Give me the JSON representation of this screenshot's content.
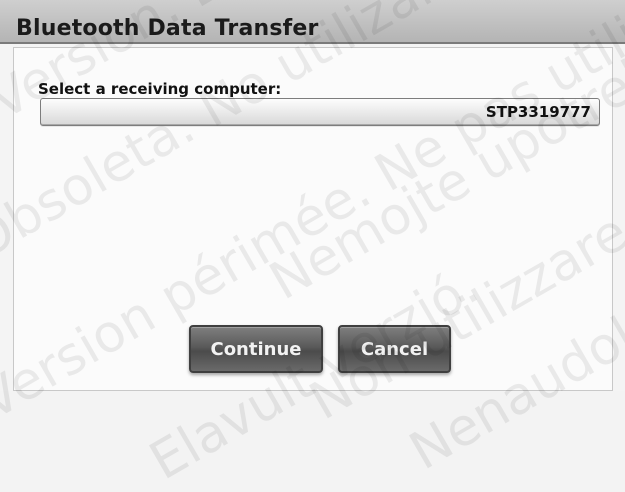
{
  "dialog": {
    "title": "Bluetooth Data Transfer",
    "select_label": "Select a receiving computer:",
    "selected_computer": "STP3319777",
    "continue_label": "Continue",
    "cancel_label": "Cancel"
  },
  "watermark": [
    "Version. Do not use.",
    "Obsoleta. No utilizar.",
    "Version périmée. Ne pas utiliser.",
    "Nemojte upotrebljavati.",
    "Non utilizzare.",
    "Nenaudokite.",
    "Elavult verzió."
  ]
}
